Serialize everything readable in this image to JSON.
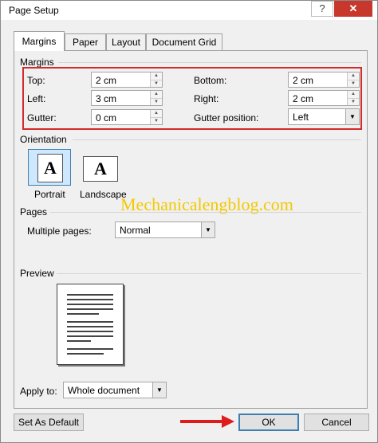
{
  "window": {
    "title": "Page Setup",
    "help_label": "?",
    "close_label": "✕"
  },
  "tabs": [
    {
      "label": "Margins",
      "active": true
    },
    {
      "label": "Paper",
      "active": false
    },
    {
      "label": "Layout",
      "active": false
    },
    {
      "label": "Document Grid",
      "active": false
    }
  ],
  "margins": {
    "group_label": "Margins",
    "top": {
      "label": "Top:",
      "value": "2 cm"
    },
    "left": {
      "label": "Left:",
      "value": "3 cm"
    },
    "gutter": {
      "label": "Gutter:",
      "value": "0 cm"
    },
    "bottom": {
      "label": "Bottom:",
      "value": "2 cm"
    },
    "right": {
      "label": "Right:",
      "value": "2 cm"
    },
    "gutter_position": {
      "label": "Gutter position:",
      "value": "Left"
    }
  },
  "orientation": {
    "group_label": "Orientation",
    "portrait_label": "Portrait",
    "landscape_label": "Landscape",
    "icon_letter": "A",
    "selected": "portrait"
  },
  "pages": {
    "group_label": "Pages",
    "multiple_pages_label": "Multiple pages:",
    "multiple_pages_value": "Normal"
  },
  "preview": {
    "group_label": "Preview"
  },
  "apply_to": {
    "label": "Apply to:",
    "value": "Whole document"
  },
  "buttons": {
    "set_default": "Set As Default",
    "ok": "OK",
    "cancel": "Cancel"
  },
  "watermark": "Mechanicalengblog.com",
  "colors": {
    "highlight_box": "#d42a2a",
    "arrow": "#e01b1b",
    "watermark": "#f3c900",
    "close_button": "#c7372b"
  }
}
